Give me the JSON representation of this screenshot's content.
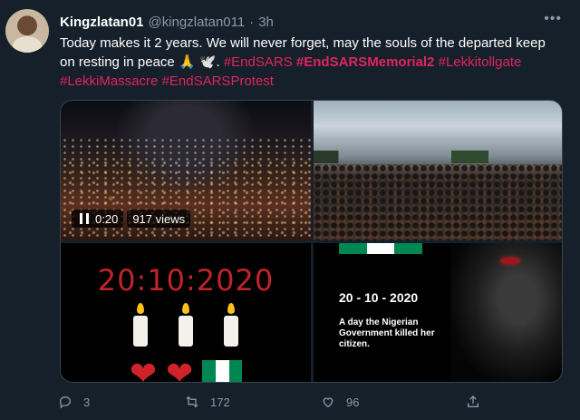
{
  "tweet": {
    "display_name": "Kingzlatan01",
    "handle": "@kingzlatan011",
    "separator": "·",
    "time": "3h",
    "more_label": "•••",
    "text_line1": "Today makes it 2 years.  We will never forget, may the souls of the departed keep",
    "text_line2": "on resting in peace",
    "emoji_pray": "🙏",
    "emoji_dove": "🕊️",
    "hashtags": [
      "#EndSARS",
      "#EndSARSMemorial2",
      "#Lekkitollgate",
      "#LekkiMassacre",
      "#EndSARSProtest"
    ]
  },
  "media": {
    "video_time": "0:20",
    "video_views": "917 views",
    "memorial_date": "20:10:2020",
    "poster_date": "20 - 10 - 2020",
    "poster_caption": "A  day the Nigerian Government killed her citizen."
  },
  "actions": {
    "replies": "3",
    "retweets": "172",
    "likes": "96"
  },
  "colors": {
    "background": "#15202b",
    "hashtag": "#e0245e",
    "muted": "#8899a6",
    "flag_green": "#008751"
  }
}
